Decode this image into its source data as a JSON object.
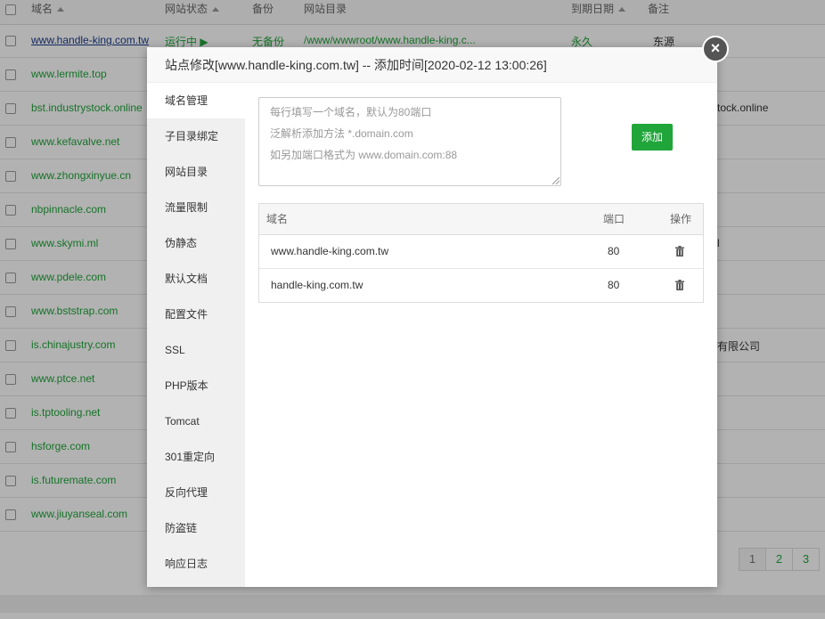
{
  "table_header": {
    "domain": "域名",
    "status": "网站状态",
    "backup": "备份",
    "dir": "网站目录",
    "expire": "到期日期",
    "note": "备注"
  },
  "sites": [
    {
      "domain": "www.handle-king.com.tw",
      "status": "运行中 ▶",
      "backup": "无备份",
      "dir": "/www/wwwroot/www.handle-king.c...",
      "expire": "永久",
      "note": "东源"
    },
    {
      "domain": "www.lermite.top",
      "note": ""
    },
    {
      "domain": "bst.industrystock.online",
      "note": "tock.online"
    },
    {
      "domain": "www.kefavalve.net",
      "note": ""
    },
    {
      "domain": "www.zhongxinyue.cn",
      "note": ""
    },
    {
      "domain": "nbpinnacle.com",
      "note": ""
    },
    {
      "domain": "www.skymi.ml",
      "note": "l"
    },
    {
      "domain": "www.pdele.com",
      "note": ""
    },
    {
      "domain": "www.bststrap.com",
      "note": ""
    },
    {
      "domain": "is.chinajustry.com",
      "note": "有限公司"
    },
    {
      "domain": "www.ptce.net",
      "note": ""
    },
    {
      "domain": "is.tptooling.net",
      "note": ""
    },
    {
      "domain": "hsforge.com",
      "note": ""
    },
    {
      "domain": "is.futuremate.com",
      "note": ""
    },
    {
      "domain": "www.jiuyanseal.com",
      "note": ""
    }
  ],
  "pagination": [
    "1",
    "2",
    "3"
  ],
  "modal": {
    "title": "站点修改[www.handle-king.com.tw] -- 添加时间[2020-02-12 13:00:26]",
    "close_icon": "×",
    "menu": [
      "域名管理",
      "子目录绑定",
      "网站目录",
      "流量限制",
      "伪静态",
      "默认文档",
      "配置文件",
      "SSL",
      "PHP版本",
      "Tomcat",
      "301重定向",
      "反向代理",
      "防盗链",
      "响应日志"
    ],
    "textarea_placeholder": [
      "每行填写一个域名，默认为80端口",
      "泛解析添加方法 *.domain.com",
      "如另加端口格式为 www.domain.com:88"
    ],
    "add_label": "添加",
    "domain_table": {
      "headers": {
        "domain": "域名",
        "port": "端口",
        "action": "操作"
      },
      "rows": [
        {
          "domain": "www.handle-king.com.tw",
          "port": "80"
        },
        {
          "domain": "handle-king.com.tw",
          "port": "80"
        }
      ]
    }
  },
  "colors": {
    "accent": "#20a53a"
  }
}
